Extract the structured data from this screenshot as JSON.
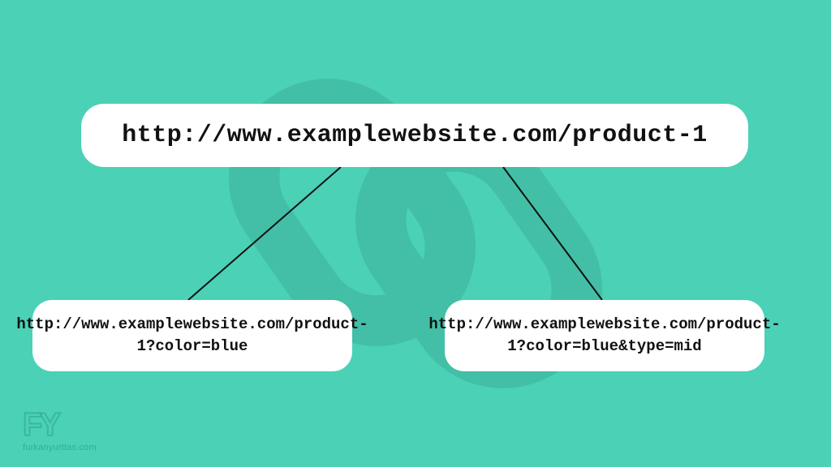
{
  "urls": {
    "parent": "http://www.examplewebsite.com/product-1",
    "child_left": "http://www.examplewebsite.com/product-1?color=blue",
    "child_right": "http://www.examplewebsite.com/product-1?color=blue&type=mid"
  },
  "watermark": {
    "initials": "FY",
    "domain": "furkanyurttas.com"
  },
  "colors": {
    "background": "#4ad1b6",
    "box": "#ffffff",
    "text": "#111111",
    "chain": "#6fb9a6"
  }
}
